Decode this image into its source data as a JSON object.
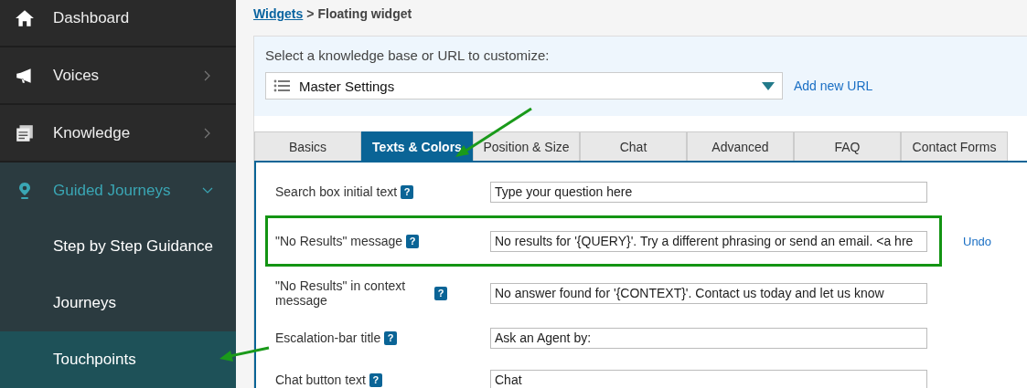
{
  "sidebar": {
    "items": [
      {
        "label": "Dashboard",
        "expanded": false,
        "has_submenu": false
      },
      {
        "label": "Voices",
        "expanded": false,
        "has_submenu": true
      },
      {
        "label": "Knowledge",
        "expanded": false,
        "has_submenu": true
      },
      {
        "label": "Guided Journeys",
        "expanded": true,
        "has_submenu": true,
        "children": [
          {
            "label": "Step by Step Guidance",
            "selected": false
          },
          {
            "label": "Journeys",
            "selected": false
          },
          {
            "label": "Touchpoints",
            "selected": true
          }
        ]
      }
    ]
  },
  "breadcrumb": {
    "link": "Widgets",
    "separator": ">",
    "current": "Floating widget"
  },
  "selector": {
    "label": "Select a knowledge base or URL to customize:",
    "value": "Master Settings",
    "add_link": "Add new URL"
  },
  "tabs": [
    {
      "label": "Basics",
      "selected": false
    },
    {
      "label": "Texts & Colors",
      "selected": true
    },
    {
      "label": "Position & Size",
      "selected": false
    },
    {
      "label": "Chat",
      "selected": false
    },
    {
      "label": "Advanced",
      "selected": false
    },
    {
      "label": "FAQ",
      "selected": false
    },
    {
      "label": "Contact Forms",
      "selected": false
    }
  ],
  "fields": [
    {
      "label": "Search box initial text",
      "help": "?",
      "value": "Type your question here",
      "highlighted": false
    },
    {
      "label": "\"No Results\" message",
      "help": "?",
      "value": "No results for '{QUERY}'. Try a different phrasing or send an email. <a hre",
      "highlighted": true,
      "undo": "Undo"
    },
    {
      "label": "\"No Results\" in context message",
      "help": "?",
      "value": "No answer found for '{CONTEXT}'. Contact us today and let us know",
      "highlighted": false
    },
    {
      "label": "Escalation-bar title",
      "help": "?",
      "value": "Ask an Agent by:",
      "highlighted": false
    },
    {
      "label": "Chat button text",
      "help": "?",
      "value": "Chat",
      "highlighted": false
    }
  ]
}
